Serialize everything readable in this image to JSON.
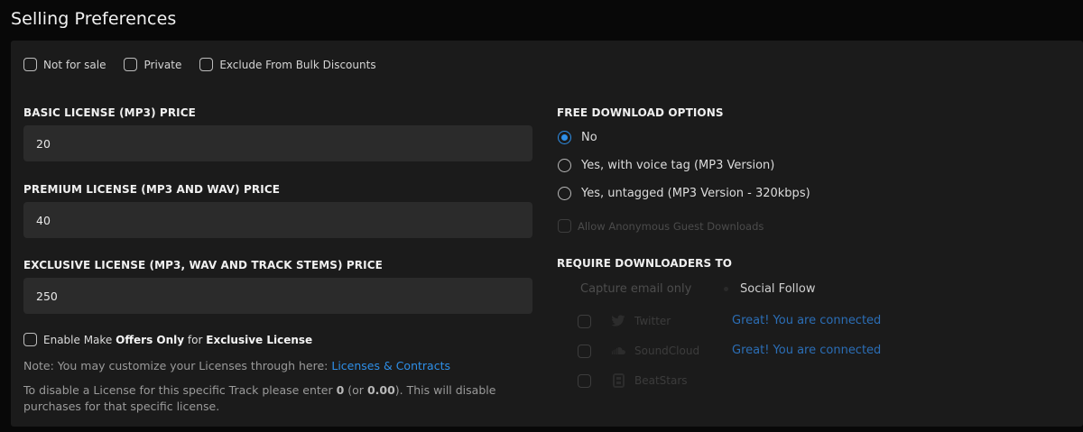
{
  "page": {
    "title": "Selling Preferences"
  },
  "top_options": [
    {
      "label": "Not for sale",
      "checked": false
    },
    {
      "label": "Private",
      "checked": false
    },
    {
      "label": "Exclude From Bulk Discounts",
      "checked": false
    }
  ],
  "licenses": {
    "basic": {
      "label": "BASIC LICENSE (MP3) PRICE",
      "value": "20"
    },
    "premium": {
      "label": "PREMIUM LICENSE (MP3 AND WAV) PRICE",
      "value": "40"
    },
    "exclusive": {
      "label": "EXCLUSIVE LICENSE (MP3, WAV AND TRACK STEMS) PRICE",
      "value": "250"
    }
  },
  "offers": {
    "prefix": "Enable Make ",
    "bold1": "Offers Only",
    "middle": " for ",
    "bold2": "Exclusive License",
    "checked": false
  },
  "notes": {
    "customize_text": "Note: You may customize your Licenses through here: ",
    "customize_link": "Licenses & Contracts",
    "disable_1": "To disable a License for this specific Track please enter ",
    "disable_zero": "0",
    "disable_2": " (or ",
    "disable_zero_dec": "0.00",
    "disable_3": "). This will disable",
    "disable_4": "purchases for that specific license."
  },
  "free_download": {
    "label": "FREE DOWNLOAD OPTIONS",
    "options": [
      {
        "label": "No",
        "selected": true
      },
      {
        "label": "Yes, with voice tag (MP3 Version)",
        "selected": false
      },
      {
        "label": "Yes, untagged (MP3 Version - 320kbps)",
        "selected": false
      }
    ],
    "guest_label": "Allow Anonymous Guest Downloads"
  },
  "require": {
    "label": "REQUIRE DOWNLOADERS TO",
    "tab_email": "Capture email only",
    "tab_social": "Social Follow",
    "socials": [
      {
        "name": "Twitter",
        "icon": "twitter-icon",
        "status": "Great! You are connected"
      },
      {
        "name": "SoundCloud",
        "icon": "soundcloud-icon",
        "status": "Great! You are connected"
      },
      {
        "name": "BeatStars",
        "icon": "beatstars-icon",
        "status": ""
      }
    ]
  },
  "colors": {
    "accent": "#2e8fe8",
    "panel": "#1b1b1b",
    "input": "#2b2b2b",
    "background": "#080808"
  }
}
